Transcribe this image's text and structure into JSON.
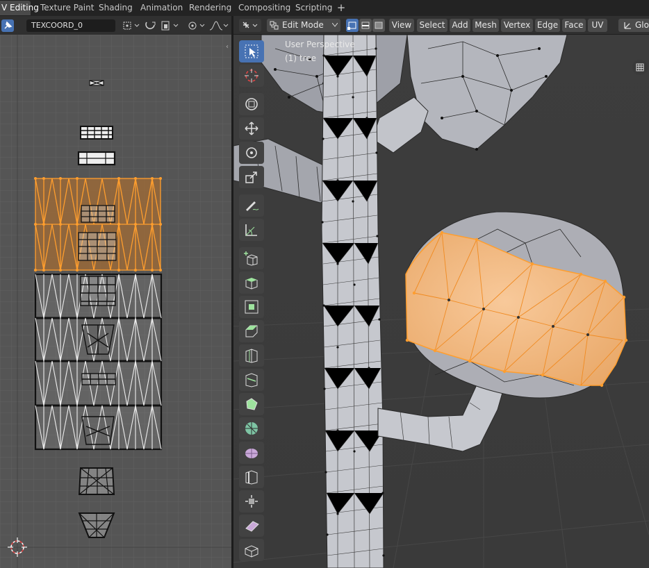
{
  "workspace_tabs": [
    {
      "label": "V Editing",
      "active": true
    },
    {
      "label": "Texture Paint",
      "active": false
    },
    {
      "label": "Shading",
      "active": false
    },
    {
      "label": "Animation",
      "active": false
    },
    {
      "label": "Rendering",
      "active": false
    },
    {
      "label": "Compositing",
      "active": false
    },
    {
      "label": "Scripting",
      "active": false
    }
  ],
  "add_workspace": "+",
  "uv_editor": {
    "uv_map_name": "TEXCOORD_0"
  },
  "viewport": {
    "mode": "Edit Mode",
    "menus": [
      "View",
      "Select",
      "Add",
      "Mesh",
      "Vertex",
      "Edge",
      "Face",
      "UV"
    ],
    "orientation": "Glo",
    "perspective_label": "User Perspective",
    "object_label": "(1) tree"
  },
  "colors": {
    "accent": "#4772b3",
    "selection": "#ff9e2e",
    "uv_background": "#555555",
    "mesh": "#a9abb2"
  },
  "tools": [
    "select-box-icon",
    "cursor-icon",
    "move-icon",
    "move-arrows-icon",
    "rotate-icon",
    "scale-icon",
    "annotate-icon",
    "measure-icon",
    "add-cube-icon",
    "extrude-icon",
    "inset-icon",
    "bevel-icon",
    "loop-cut-icon",
    "knife-icon",
    "poly-build-icon",
    "spin-icon",
    "smooth-icon",
    "edge-slide-icon",
    "shrink-fatten-icon",
    "shear-icon",
    "rip-icon"
  ]
}
